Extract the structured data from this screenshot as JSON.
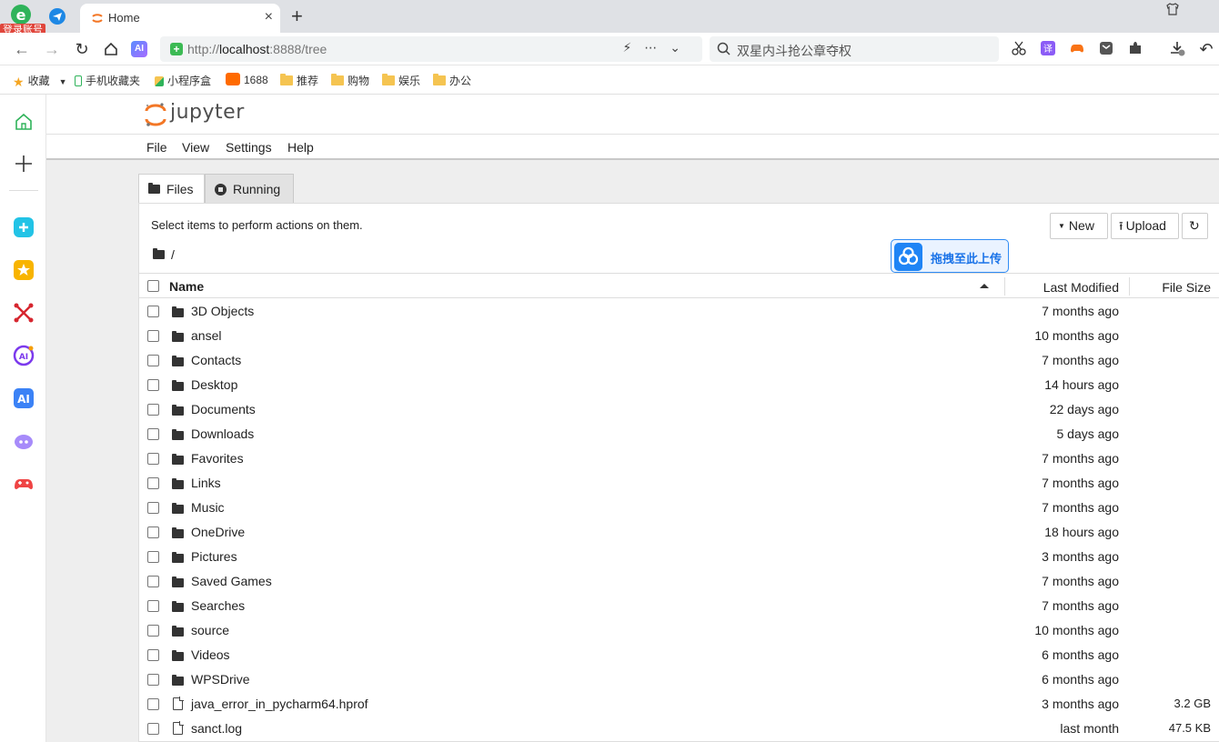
{
  "browser": {
    "login_badge": "登录账号",
    "tab_title": "Home",
    "tab_close": "×",
    "new_tab": "+",
    "url_scheme": "http://",
    "url_host": "localhost",
    "url_rest": ":8888/tree",
    "omni_icons": "⚡⋯⌄",
    "search_text": "双星内斗抢公章夺权",
    "ai_label": "AI"
  },
  "bookmarks": [
    {
      "label": "收藏",
      "icon": "star-icon"
    },
    {
      "label": "手机收藏夹",
      "icon": "phone-icon"
    },
    {
      "label": "小程序盒",
      "icon": "cube-icon"
    },
    {
      "label": "1688",
      "icon": "1688-icon"
    },
    {
      "label": "推荐",
      "icon": "folder-icon"
    },
    {
      "label": "购物",
      "icon": "folder-icon"
    },
    {
      "label": "娱乐",
      "icon": "folder-icon"
    },
    {
      "label": "办公",
      "icon": "folder-icon"
    }
  ],
  "jupyter": {
    "logo_text": "jupyter",
    "menu": [
      "File",
      "View",
      "Settings",
      "Help"
    ],
    "tabs": [
      "Files",
      "Running"
    ],
    "hint": "Select items to perform actions on them.",
    "buttons": {
      "new": "New",
      "upload": "Upload"
    },
    "breadcrumb": "/",
    "baidu_label": "拖拽至此上传",
    "columns": {
      "name": "Name",
      "modified": "Last Modified",
      "size": "File Size"
    },
    "rows": [
      {
        "name": "3D Objects",
        "type": "folder",
        "modified": "7 months ago",
        "size": ""
      },
      {
        "name": "ansel",
        "type": "folder",
        "modified": "10 months ago",
        "size": ""
      },
      {
        "name": "Contacts",
        "type": "folder",
        "modified": "7 months ago",
        "size": ""
      },
      {
        "name": "Desktop",
        "type": "folder",
        "modified": "14 hours ago",
        "size": ""
      },
      {
        "name": "Documents",
        "type": "folder",
        "modified": "22 days ago",
        "size": ""
      },
      {
        "name": "Downloads",
        "type": "folder",
        "modified": "5 days ago",
        "size": ""
      },
      {
        "name": "Favorites",
        "type": "folder",
        "modified": "7 months ago",
        "size": ""
      },
      {
        "name": "Links",
        "type": "folder",
        "modified": "7 months ago",
        "size": ""
      },
      {
        "name": "Music",
        "type": "folder",
        "modified": "7 months ago",
        "size": ""
      },
      {
        "name": "OneDrive",
        "type": "folder",
        "modified": "18 hours ago",
        "size": ""
      },
      {
        "name": "Pictures",
        "type": "folder",
        "modified": "3 months ago",
        "size": ""
      },
      {
        "name": "Saved Games",
        "type": "folder",
        "modified": "7 months ago",
        "size": ""
      },
      {
        "name": "Searches",
        "type": "folder",
        "modified": "7 months ago",
        "size": ""
      },
      {
        "name": "source",
        "type": "folder",
        "modified": "10 months ago",
        "size": ""
      },
      {
        "name": "Videos",
        "type": "folder",
        "modified": "6 months ago",
        "size": ""
      },
      {
        "name": "WPSDrive",
        "type": "folder",
        "modified": "6 months ago",
        "size": ""
      },
      {
        "name": "java_error_in_pycharm64.hprof",
        "type": "file",
        "modified": "3 months ago",
        "size": "3.2 GB"
      },
      {
        "name": "sanct.log",
        "type": "file",
        "modified": "last month",
        "size": "47.5 KB"
      }
    ]
  },
  "colors": {
    "jupyter_orange": "#f37726",
    "accent_blue": "#1a73e8",
    "folder_yellow": "#f5c451"
  }
}
